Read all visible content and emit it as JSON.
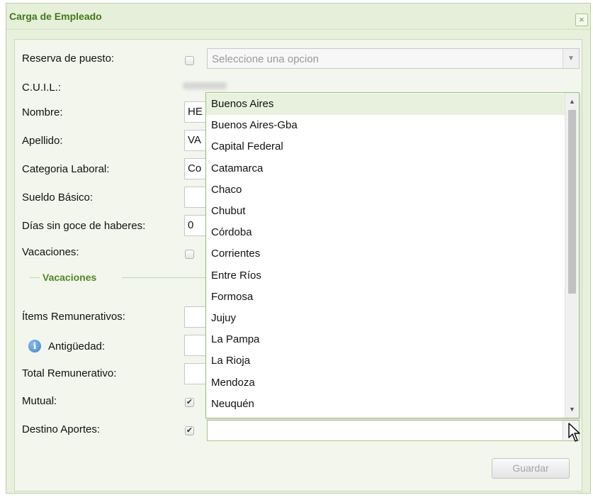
{
  "window": {
    "title": "Carga de Empleado",
    "close_glyph": "×"
  },
  "form": {
    "reserva_label": "Reserva de puesto:",
    "reserva_placeholder": "Seleccione una opcion",
    "cuil_label": "C.U.I.L.:",
    "nombre_label": "Nombre:",
    "nombre_value": "HE",
    "apellido_label": "Apellido:",
    "apellido_value": "VA",
    "categoria_label": "Categoria Laboral:",
    "categoria_value": "Co",
    "sueldo_label": "Sueldo Básico:",
    "dias_label": "Días sin goce de haberes:",
    "dias_value": "0",
    "vacaciones_label": "Vacaciones:",
    "vacaciones_legend": "Vacaciones",
    "items_label": "Ítems Remunerativos:",
    "antiguedad_label": "Antigüedad:",
    "total_label": "Total Remunerativo:",
    "mutual_label": "Mutual:",
    "destino_label": "Destino Aportes:",
    "check_glyph": "✔",
    "guardar_label": "Guardar"
  },
  "dropdown": {
    "options": [
      "Buenos Aires",
      "Buenos Aires-Gba",
      "Capital Federal",
      "Catamarca",
      "Chaco",
      "Chubut",
      "Córdoba",
      "Corrientes",
      "Entre Ríos",
      "Formosa",
      "Jujuy",
      "La Pampa",
      "La Rioja",
      "Mendoza",
      "Neuquén"
    ],
    "highlighted": "Buenos Aires"
  },
  "icons": {
    "info": "info-icon",
    "close": "close-icon",
    "arrow": "chevron-down-icon",
    "cursor": "mouse-pointer-icon"
  },
  "colors": {
    "accent": "#3f7a18",
    "frame": "#e8f0dc"
  }
}
